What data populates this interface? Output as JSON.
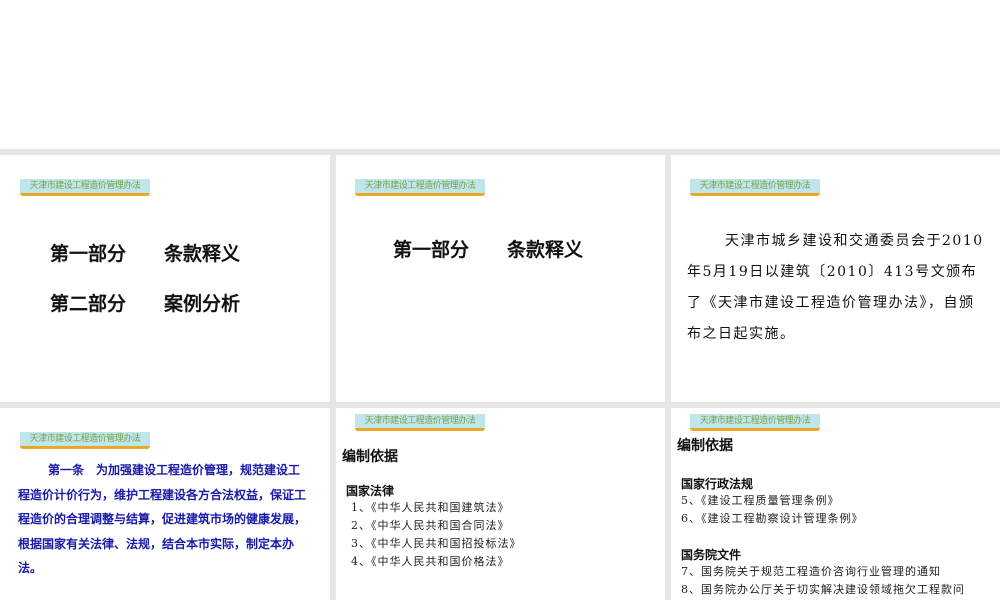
{
  "banner": "天津市建设工程造价管理办法",
  "slide1": {
    "line1": "第一部分　　条款释义",
    "line2": "第二部分　　案例分析"
  },
  "slide2": {
    "title": "第一部分　　条款释义"
  },
  "slide3": {
    "text": "天津市城乡建设和交通委员会于2010年5月19日以建筑〔2010〕413号文颁布了《天津市建设工程造价管理办法》，自颁布之日起实施。"
  },
  "slide4": {
    "text": "第一条　为加强建设工程造价管理，规范建设工程造价计价行为，维护工程建设各方合法权益，保证工程造价的合理调整与结算，促进建筑市场的健康发展，根据国家有关法律、法规，结合本市实际，制定本办法。"
  },
  "slide5": {
    "heading": "编制依据",
    "section": "国家法律",
    "items": [
      "1、《中华人民共和国建筑法》",
      "2、《中华人民共和国合同法》",
      "3、《中华人民共和国招投标法》",
      "4、《中华人民共和国价格法》"
    ]
  },
  "slide6": {
    "heading": "编制依据",
    "section1": "国家行政法规",
    "items1": [
      "5、《建设工程质量管理条例》",
      "6、《建设工程勘察设计管理条例》"
    ],
    "section2": "国务院文件",
    "items2": [
      "7、国务院关于规范工程造价咨询行业管理的通知",
      "8、国务院办公厅关于切实解决建设领域拖欠工程款问"
    ]
  }
}
